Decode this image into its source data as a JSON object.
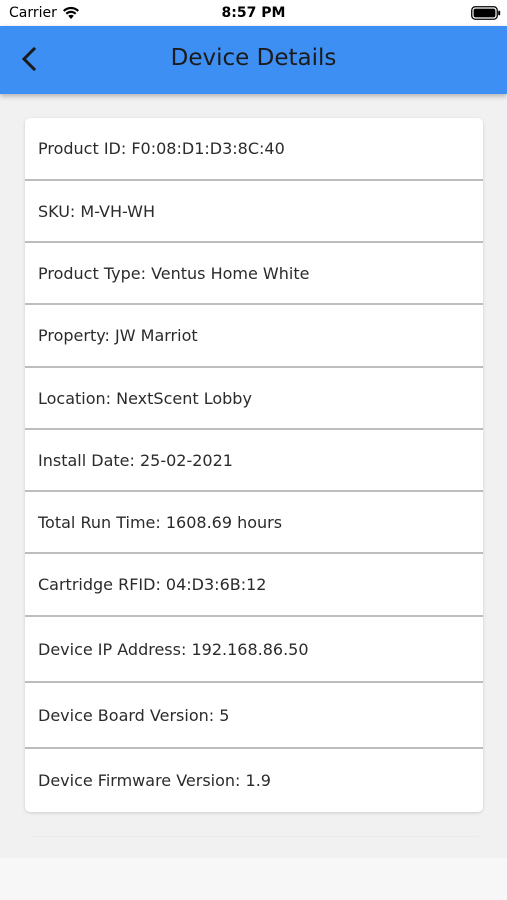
{
  "status_bar": {
    "carrier": "Carrier",
    "time": "8:57 PM"
  },
  "app_bar": {
    "title": "Device Details",
    "back_icon": "chevron-left-icon",
    "background_color": "#3d8ff4"
  },
  "details": [
    {
      "label": "Product ID: F0:08:D1:D3:8C:40"
    },
    {
      "label": "SKU: M-VH-WH"
    },
    {
      "label": "Product Type: Ventus Home White"
    },
    {
      "label": "Property: JW Marriot"
    },
    {
      "label": "Location: NextScent Lobby"
    },
    {
      "label": "Install Date: 25-02-2021"
    },
    {
      "label": "Total Run Time: 1608.69 hours"
    },
    {
      "label": "Cartridge RFID: 04:D3:6B:12"
    },
    {
      "label": "Device IP Address: 192.168.86.50"
    },
    {
      "label": "Device Board Version: 5"
    },
    {
      "label": "Device Firmware Version: 1.9"
    }
  ]
}
